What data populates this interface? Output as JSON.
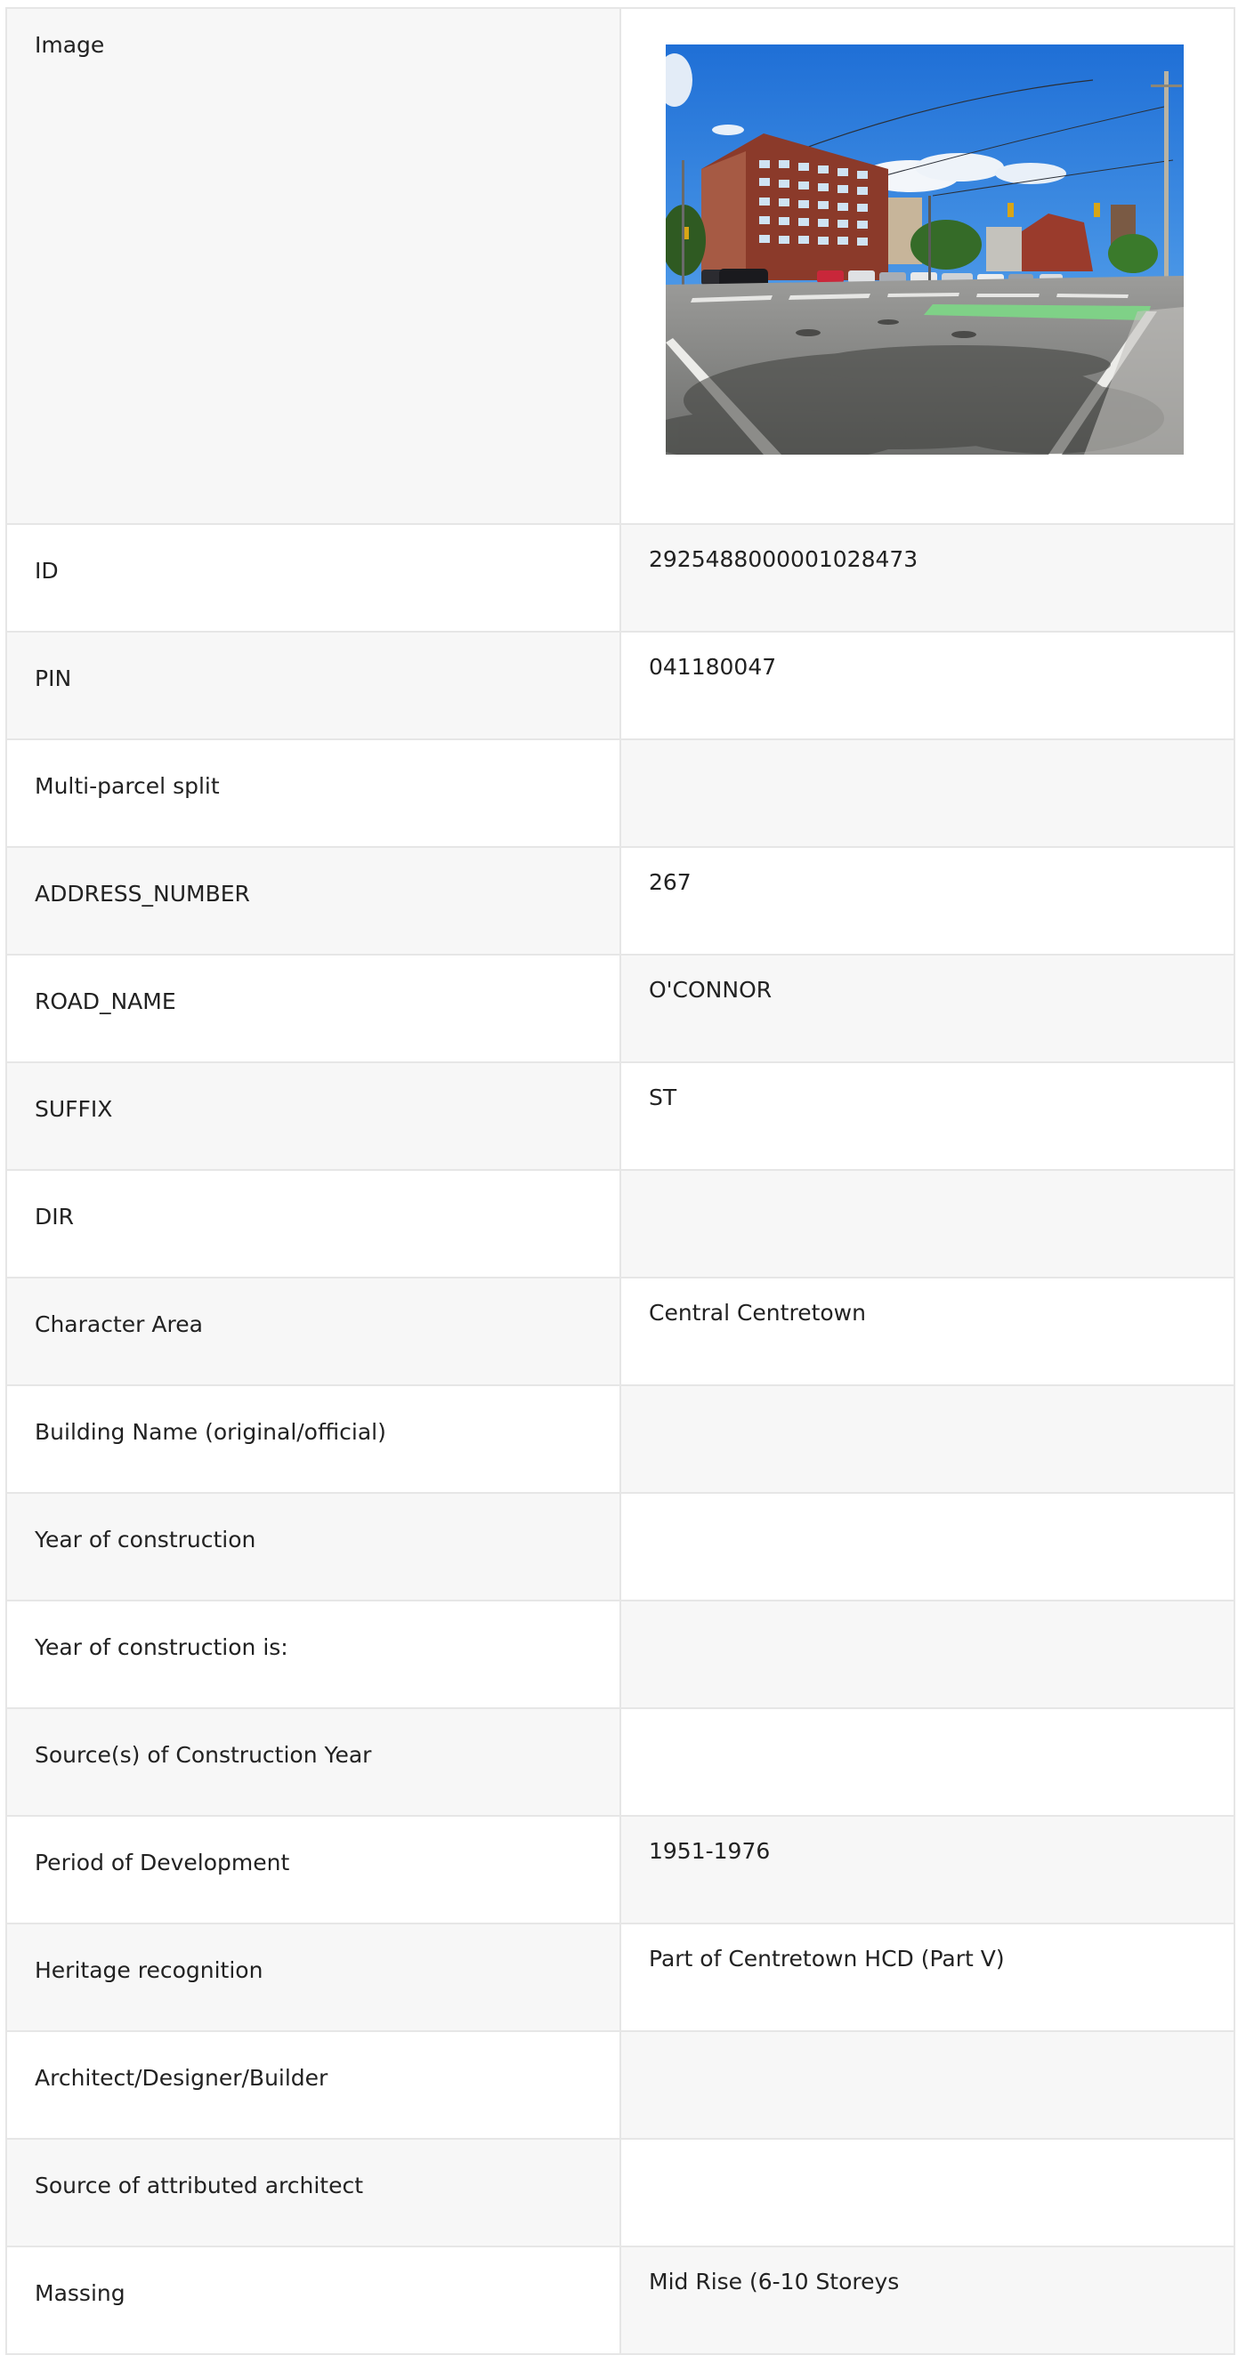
{
  "table": {
    "image_label": "Image",
    "rows": [
      {
        "label": "ID",
        "value": "2925488000001028473"
      },
      {
        "label": "PIN",
        "value": "041180047"
      },
      {
        "label": "Multi-parcel split",
        "value": ""
      },
      {
        "label": "ADDRESS_NUMBER",
        "value": "267"
      },
      {
        "label": "ROAD_NAME",
        "value": "O'CONNOR"
      },
      {
        "label": "SUFFIX",
        "value": "ST"
      },
      {
        "label": "DIR",
        "value": ""
      },
      {
        "label": "Character Area",
        "value": "Central Centretown"
      },
      {
        "label": "Building Name (original/official)",
        "value": ""
      },
      {
        "label": "Year of construction",
        "value": ""
      },
      {
        "label": "Year of construction is:",
        "value": ""
      },
      {
        "label": "Source(s) of Construction Year",
        "value": ""
      },
      {
        "label": "Period of Development",
        "value": "1951-1976"
      },
      {
        "label": "Heritage recognition",
        "value": "Part of Centretown HCD (Part V)"
      },
      {
        "label": "Architect/Designer/Builder",
        "value": ""
      },
      {
        "label": "Source of attributed architect",
        "value": ""
      },
      {
        "label": "Massing",
        "value": "Mid Rise (6-10 Storeys"
      }
    ]
  }
}
